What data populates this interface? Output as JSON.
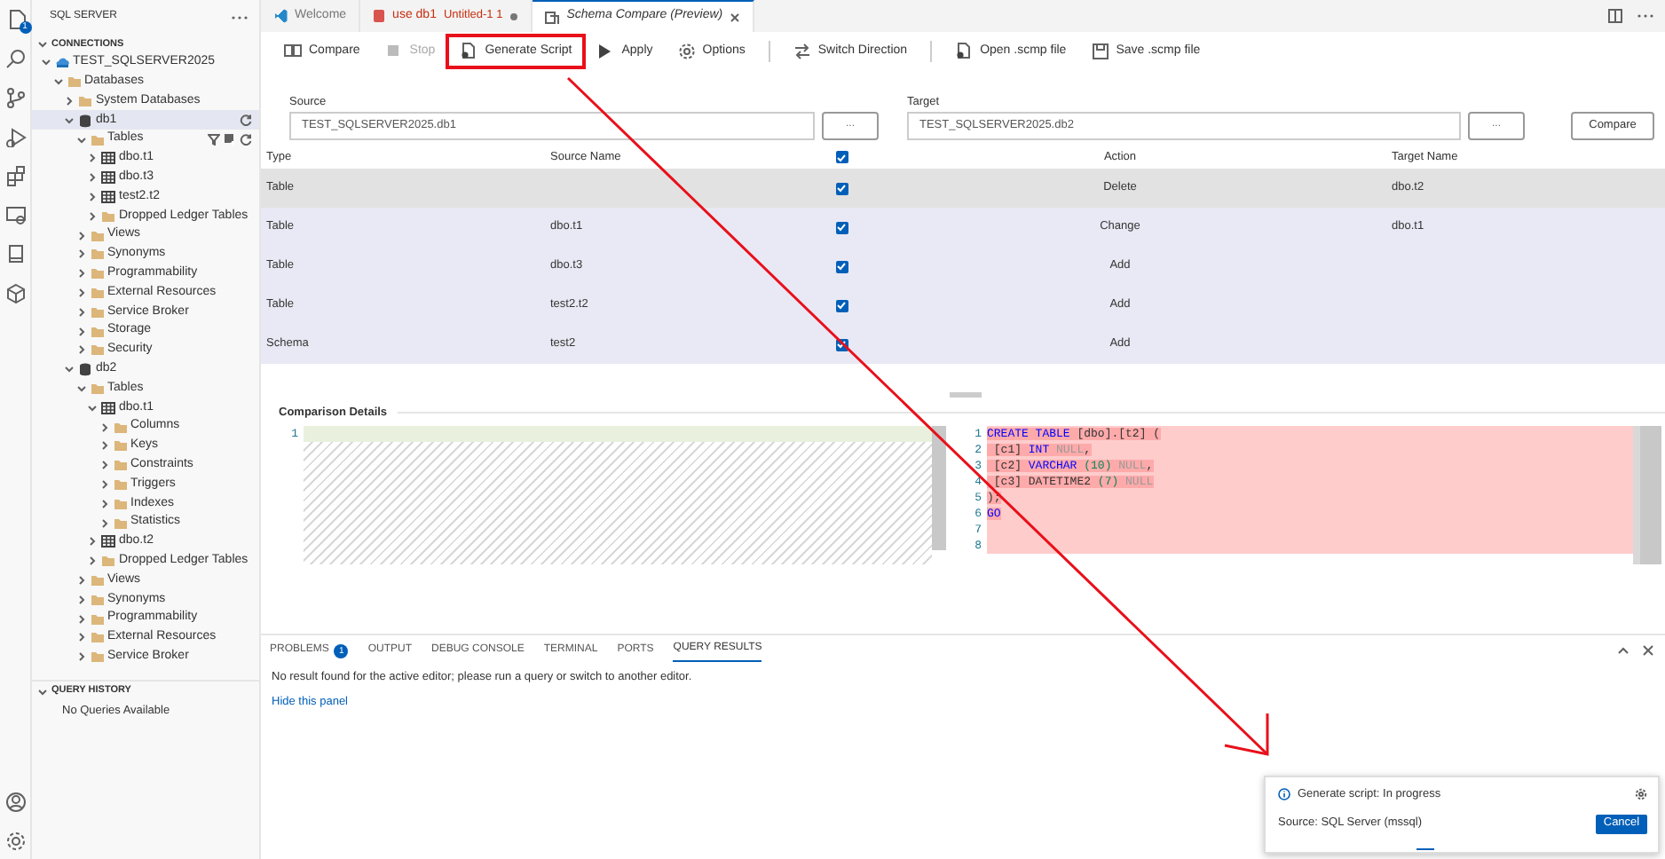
{
  "activity_bar": {
    "explorer_badge": "1"
  },
  "sidebar": {
    "title": "SQL SERVER",
    "connections": {
      "title": "CONNECTIONS",
      "expanded": true,
      "tree": [
        {
          "label": "TEST_SQLSERVER2025",
          "kind": "server",
          "expanded": true,
          "selected": false,
          "children": [
            {
              "label": "Databases",
              "kind": "folder",
              "expanded": true,
              "selected": false,
              "children": [
                {
                  "label": "System Databases",
                  "kind": "folder",
                  "expanded": false,
                  "selected": false
                },
                {
                  "label": "db1",
                  "kind": "database",
                  "expanded": true,
                  "selected": true,
                  "children": [
                    {
                      "label": "Tables",
                      "kind": "folder",
                      "expanded": true,
                      "selected": false,
                      "show_actions": true,
                      "children": [
                        {
                          "label": "dbo.t1",
                          "kind": "table",
                          "expanded": false,
                          "selected": false
                        },
                        {
                          "label": "dbo.t3",
                          "kind": "table",
                          "expanded": false,
                          "selected": false
                        },
                        {
                          "label": "test2.t2",
                          "kind": "table",
                          "expanded": false,
                          "selected": false
                        },
                        {
                          "label": "Dropped Ledger Tables",
                          "kind": "folder",
                          "expanded": false,
                          "selected": false
                        }
                      ]
                    },
                    {
                      "label": "Views",
                      "kind": "folder",
                      "expanded": false,
                      "selected": false
                    },
                    {
                      "label": "Synonyms",
                      "kind": "folder",
                      "expanded": false,
                      "selected": false
                    },
                    {
                      "label": "Programmability",
                      "kind": "folder",
                      "expanded": false,
                      "selected": false
                    },
                    {
                      "label": "External Resources",
                      "kind": "folder",
                      "expanded": false,
                      "selected": false
                    },
                    {
                      "label": "Service Broker",
                      "kind": "folder",
                      "expanded": false,
                      "selected": false
                    },
                    {
                      "label": "Storage",
                      "kind": "folder",
                      "expanded": false,
                      "selected": false
                    },
                    {
                      "label": "Security",
                      "kind": "folder",
                      "expanded": false,
                      "selected": false
                    }
                  ]
                },
                {
                  "label": "db2",
                  "kind": "database",
                  "expanded": true,
                  "selected": false,
                  "children": [
                    {
                      "label": "Tables",
                      "kind": "folder",
                      "expanded": true,
                      "selected": false,
                      "children": [
                        {
                          "label": "dbo.t1",
                          "kind": "table",
                          "expanded": true,
                          "selected": false,
                          "children": [
                            {
                              "label": "Columns",
                              "kind": "folder",
                              "expanded": false,
                              "selected": false
                            },
                            {
                              "label": "Keys",
                              "kind": "folder",
                              "expanded": false,
                              "selected": false
                            },
                            {
                              "label": "Constraints",
                              "kind": "folder",
                              "expanded": false,
                              "selected": false
                            },
                            {
                              "label": "Triggers",
                              "kind": "folder",
                              "expanded": false,
                              "selected": false
                            },
                            {
                              "label": "Indexes",
                              "kind": "folder",
                              "expanded": false,
                              "selected": false
                            },
                            {
                              "label": "Statistics",
                              "kind": "folder",
                              "expanded": false,
                              "selected": false
                            }
                          ]
                        },
                        {
                          "label": "dbo.t2",
                          "kind": "table",
                          "expanded": false,
                          "selected": false
                        },
                        {
                          "label": "Dropped Ledger Tables",
                          "kind": "folder",
                          "expanded": false,
                          "selected": false
                        }
                      ]
                    },
                    {
                      "label": "Views",
                      "kind": "folder",
                      "expanded": false,
                      "selected": false
                    },
                    {
                      "label": "Synonyms",
                      "kind": "folder",
                      "expanded": false,
                      "selected": false
                    },
                    {
                      "label": "Programmability",
                      "kind": "folder",
                      "expanded": false,
                      "selected": false
                    },
                    {
                      "label": "External Resources",
                      "kind": "folder",
                      "expanded": false,
                      "selected": false
                    },
                    {
                      "label": "Service Broker",
                      "kind": "folder",
                      "expanded": false,
                      "selected": false
                    }
                  ]
                }
              ]
            }
          ]
        }
      ]
    },
    "query_history": {
      "title": "QUERY HISTORY",
      "expanded": true,
      "empty_message": "No Queries Available"
    }
  },
  "editor_tabs": [
    {
      "label": "Welcome",
      "kind": "welcome",
      "selected": false
    },
    {
      "label": "use db1",
      "description": "Untitled-1 1",
      "kind": "query",
      "error": true,
      "modified": true,
      "selected": false
    },
    {
      "label": "Schema Compare (Preview)",
      "kind": "compare",
      "preview": true,
      "selected": true
    }
  ],
  "toolbar": {
    "groups": [
      [
        {
          "label": "Compare",
          "disabled": false
        },
        {
          "label": "Stop",
          "disabled": true
        },
        {
          "label": "Generate Script",
          "disabled": false,
          "highlighted": true
        },
        {
          "label": "Apply",
          "disabled": false
        },
        {
          "label": "Options",
          "disabled": false
        }
      ],
      [
        {
          "label": "Switch Direction",
          "disabled": false
        }
      ],
      [
        {
          "label": "Open .scmp file",
          "disabled": false
        },
        {
          "label": "Save .scmp file",
          "disabled": false
        }
      ]
    ]
  },
  "source": {
    "label": "Source",
    "value": "TEST_SQLSERVER2025.db1",
    "browse": "..."
  },
  "target": {
    "label": "Target",
    "value": "TEST_SQLSERVER2025.db2",
    "browse": "..."
  },
  "compare_button": "Compare",
  "table": {
    "columns": {
      "type": "Type",
      "source_name": "Source Name",
      "include_all": true,
      "action": "Action",
      "target_name": "Target Name"
    },
    "rows": [
      {
        "type": "Table",
        "include": true,
        "action": "Delete",
        "target_name": "dbo.t2",
        "selected": true
      },
      {
        "type": "Table",
        "source_name": "dbo.t1",
        "include": true,
        "action": "Change",
        "target_name": "dbo.t1",
        "selected": false
      },
      {
        "type": "Table",
        "source_name": "dbo.t3",
        "include": true,
        "action": "Add",
        "selected": false
      },
      {
        "type": "Table",
        "source_name": "test2.t2",
        "include": true,
        "action": "Add",
        "selected": false
      },
      {
        "type": "Schema",
        "source_name": "test2",
        "include": true,
        "action": "Add",
        "selected": false
      }
    ]
  },
  "details": {
    "title": "Comparison Details",
    "source_lines": [
      {
        "number": "1"
      }
    ],
    "target_lines": [
      {
        "number": "1",
        "tokens": [
          {
            "t": "CREATE TABLE",
            "kind": "keyword"
          },
          {
            "t": " [dbo].[t2] (",
            "kind": "plain"
          }
        ]
      },
      {
        "number": "2",
        "tokens": [
          {
            "t": " [c1] ",
            "kind": "plain"
          },
          {
            "t": "INT",
            "kind": "keyword"
          },
          {
            "t": " NULL",
            "kind": "null"
          },
          {
            "t": ",",
            "kind": "plain"
          }
        ]
      },
      {
        "number": "3",
        "tokens": [
          {
            "t": " [c2] ",
            "kind": "plain"
          },
          {
            "t": "VARCHAR",
            "kind": "keyword"
          },
          {
            "t": " (10)",
            "kind": "number"
          },
          {
            "t": " NULL",
            "kind": "null"
          },
          {
            "t": ",",
            "kind": "plain"
          }
        ]
      },
      {
        "number": "4",
        "tokens": [
          {
            "t": " [c3] ",
            "kind": "plain"
          },
          {
            "t": "DATETIME2",
            "kind": "plain"
          },
          {
            "t": " (7)",
            "kind": "number"
          },
          {
            "t": " NULL",
            "kind": "null"
          }
        ]
      },
      {
        "number": "5",
        "tokens": [
          {
            "t": ");",
            "kind": "plain"
          }
        ]
      },
      {
        "number": "6",
        "tokens": [
          {
            "t": "GO",
            "kind": "keyword"
          }
        ]
      },
      {
        "number": "7"
      },
      {
        "number": "8"
      }
    ]
  },
  "panel": {
    "tabs": [
      {
        "label": "PROBLEMS",
        "badge": "1",
        "selected": false
      },
      {
        "label": "OUTPUT",
        "selected": false
      },
      {
        "label": "DEBUG CONSOLE",
        "selected": false
      },
      {
        "label": "TERMINAL",
        "selected": false
      },
      {
        "label": "PORTS",
        "selected": false
      },
      {
        "label": "QUERY RESULTS",
        "selected": true
      }
    ],
    "message": "No result found for the active editor; please run a query or switch to another editor.",
    "link": "Hide this panel"
  },
  "notification": {
    "title": "Generate script: In progress",
    "source": "Source: SQL Server (mssql)",
    "button": "Cancel"
  }
}
